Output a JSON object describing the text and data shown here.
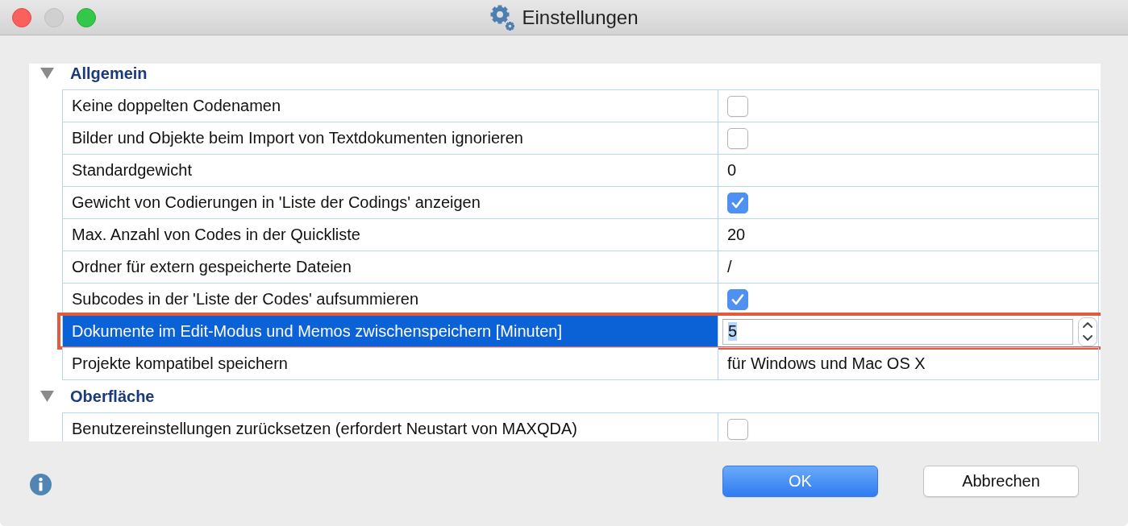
{
  "window": {
    "title": "Einstellungen",
    "controls": [
      {
        "kind": "close",
        "disabled": false
      },
      {
        "kind": "minimize",
        "disabled": true
      },
      {
        "kind": "zoom",
        "disabled": false
      }
    ]
  },
  "groups": [
    {
      "title": "Allgemein",
      "expanded": true,
      "children": [
        {
          "label": "Keine doppelten Codenamen",
          "kind": "checkbox",
          "checked": false,
          "selected": false,
          "highlighted": false
        },
        {
          "label": "Bilder und Objekte beim Import von Textdokumenten ignorieren",
          "kind": "checkbox",
          "checked": false,
          "selected": false,
          "highlighted": false
        },
        {
          "label": "Standardgewicht",
          "kind": "text",
          "value": "0",
          "selected": false,
          "highlighted": false
        },
        {
          "label": "Gewicht von Codierungen in 'Liste der Codings' anzeigen",
          "kind": "checkbox",
          "checked": true,
          "selected": false,
          "highlighted": false
        },
        {
          "label": "Max. Anzahl von Codes in der Quickliste",
          "kind": "text",
          "value": "20",
          "selected": false,
          "highlighted": false
        },
        {
          "label": "Ordner für extern gespeicherte Dateien",
          "kind": "text",
          "value": "/",
          "selected": false,
          "highlighted": false
        },
        {
          "label": "Subcodes in der 'Liste der Codes' aufsummieren",
          "kind": "checkbox",
          "checked": true,
          "selected": false,
          "highlighted": false
        },
        {
          "label": "Dokumente im Edit-Modus und Memos zwischenspeichern [Minuten]",
          "kind": "number",
          "value": "5",
          "value_selected": true,
          "selected": true,
          "highlighted": true
        },
        {
          "label": "Projekte kompatibel speichern",
          "kind": "text",
          "value": "für Windows und Mac OS X",
          "selected": false,
          "highlighted": false
        }
      ]
    },
    {
      "title": "Oberfläche",
      "expanded": true,
      "children": [
        {
          "label": "Benutzereinstellungen zurücksetzen (erfordert Neustart von MAXQDA)",
          "kind": "checkbox",
          "checked": false,
          "selected": false,
          "highlighted": false
        }
      ]
    }
  ],
  "buttons": [
    {
      "label": "OK",
      "default": true
    },
    {
      "label": "Abbrechen",
      "default": false
    }
  ]
}
